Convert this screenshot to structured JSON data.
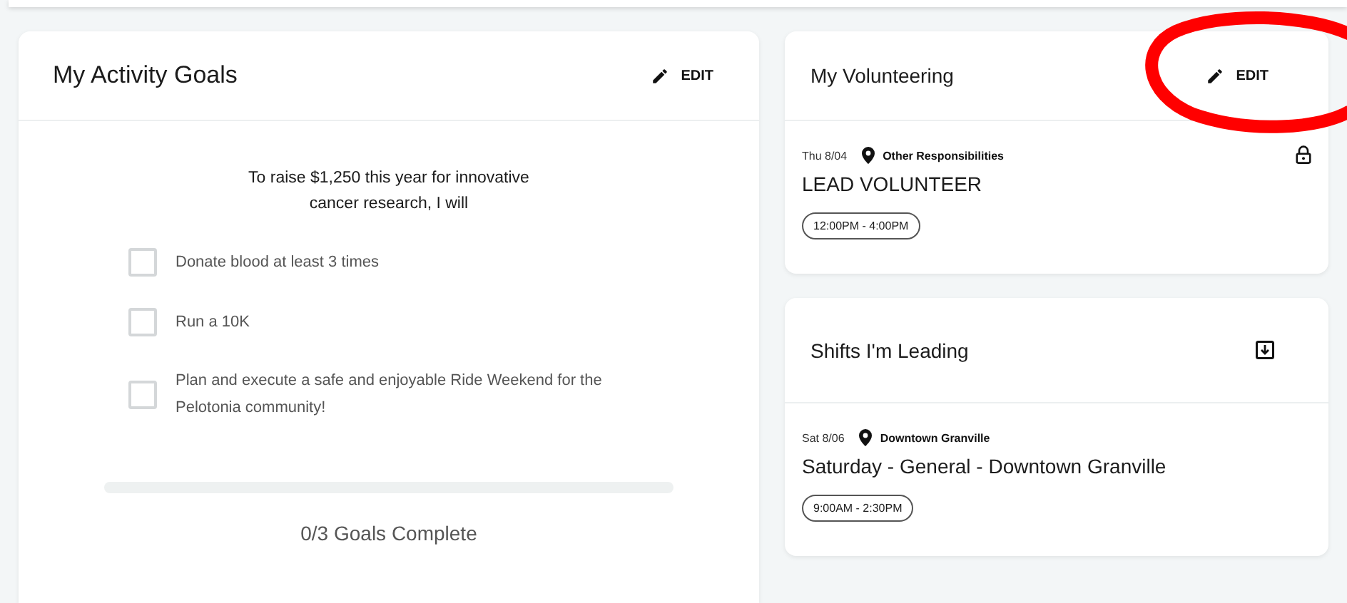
{
  "goals_card": {
    "title": "My Activity Goals",
    "edit_label": "EDIT",
    "intro": "To raise $1,250 this year for innovative cancer research, I will",
    "goals": [
      {
        "label": "Donate blood at least 3 times",
        "checked": false
      },
      {
        "label": "Run a 10K",
        "checked": false
      },
      {
        "label": "Plan and execute a safe and enjoyable Ride Weekend for the Pelotonia community!",
        "checked": false
      }
    ],
    "progress": {
      "level": 0
    },
    "summary": "0/3 Goals Complete"
  },
  "volunteering_card": {
    "title": "My Volunteering",
    "edit_label": "EDIT",
    "kind": "edit",
    "shifts": [
      {
        "date": "Thu 8/04",
        "location": "Other Responsibilities",
        "name": "LEAD VOLUNTEER",
        "time": "12:00PM - 4:00PM",
        "locked": true
      }
    ]
  },
  "leading_card": {
    "title": "Shifts I'm Leading",
    "kind": "download",
    "shifts": [
      {
        "date": "Sat 8/06",
        "location": "Downtown Granville",
        "name": "Saturday - General - Downtown Granville",
        "time": "9:00AM - 2:30PM"
      }
    ]
  },
  "highlight": {
    "kind": "ellipse"
  }
}
